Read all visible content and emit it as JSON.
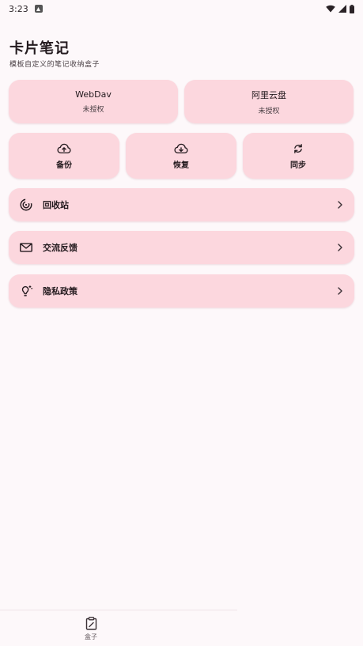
{
  "status_bar": {
    "time": "3:23"
  },
  "header": {
    "title": "卡片笔记",
    "subtitle": "模板自定义的笔记收纳盒子"
  },
  "cloud_accounts": [
    {
      "name": "WebDav",
      "status": "未授权"
    },
    {
      "name": "阿里云盘",
      "status": "未授权"
    }
  ],
  "actions": [
    {
      "label": "备份",
      "icon": "cloud-upload-icon"
    },
    {
      "label": "恢复",
      "icon": "cloud-download-icon"
    },
    {
      "label": "同步",
      "icon": "sync-icon"
    }
  ],
  "menu": [
    {
      "label": "回收站",
      "icon": "recycle-icon"
    },
    {
      "label": "交流反馈",
      "icon": "mail-icon"
    },
    {
      "label": "隐私政策",
      "icon": "lightbulb-icon"
    }
  ],
  "bottom_nav": {
    "items": [
      {
        "label": "盒子",
        "icon": "clipboard-icon"
      }
    ]
  },
  "colors": {
    "background": "#fdf8fa",
    "card": "#fcd7de",
    "text": "#231a1e"
  }
}
